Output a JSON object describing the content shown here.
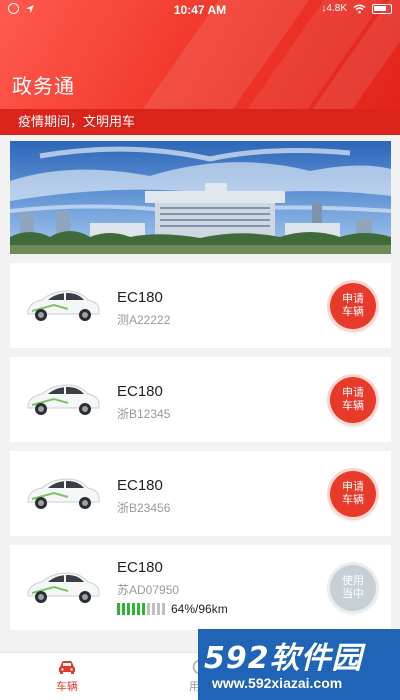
{
  "status_bar": {
    "time": "10:47 AM",
    "network_speed": "4.8K"
  },
  "header": {
    "title": "政务通",
    "notice": "疫情期间，文明用车",
    "brand_color": "#e73a2b"
  },
  "banner": {
    "image": "government-building-photo"
  },
  "vehicles": [
    {
      "model": "EC180",
      "plate": "测A22222",
      "action": "申请车辆",
      "available": true
    },
    {
      "model": "EC180",
      "plate": "浙B12345",
      "action": "申请车辆",
      "available": true
    },
    {
      "model": "EC180",
      "plate": "浙B23456",
      "action": "申请车辆",
      "available": true
    },
    {
      "model": "EC180",
      "plate": "苏AD07950",
      "action": "使用当中",
      "available": false,
      "battery_percent": 64,
      "range_text": "64%/96km"
    }
  ],
  "tabbar": {
    "tabs": [
      {
        "label": "车辆",
        "icon": "car-icon",
        "active": true
      },
      {
        "label": "用车",
        "icon": "clock-icon",
        "active": false
      }
    ]
  },
  "watermark": {
    "logo": "592软件园",
    "url": "www.592xiazai.com"
  }
}
